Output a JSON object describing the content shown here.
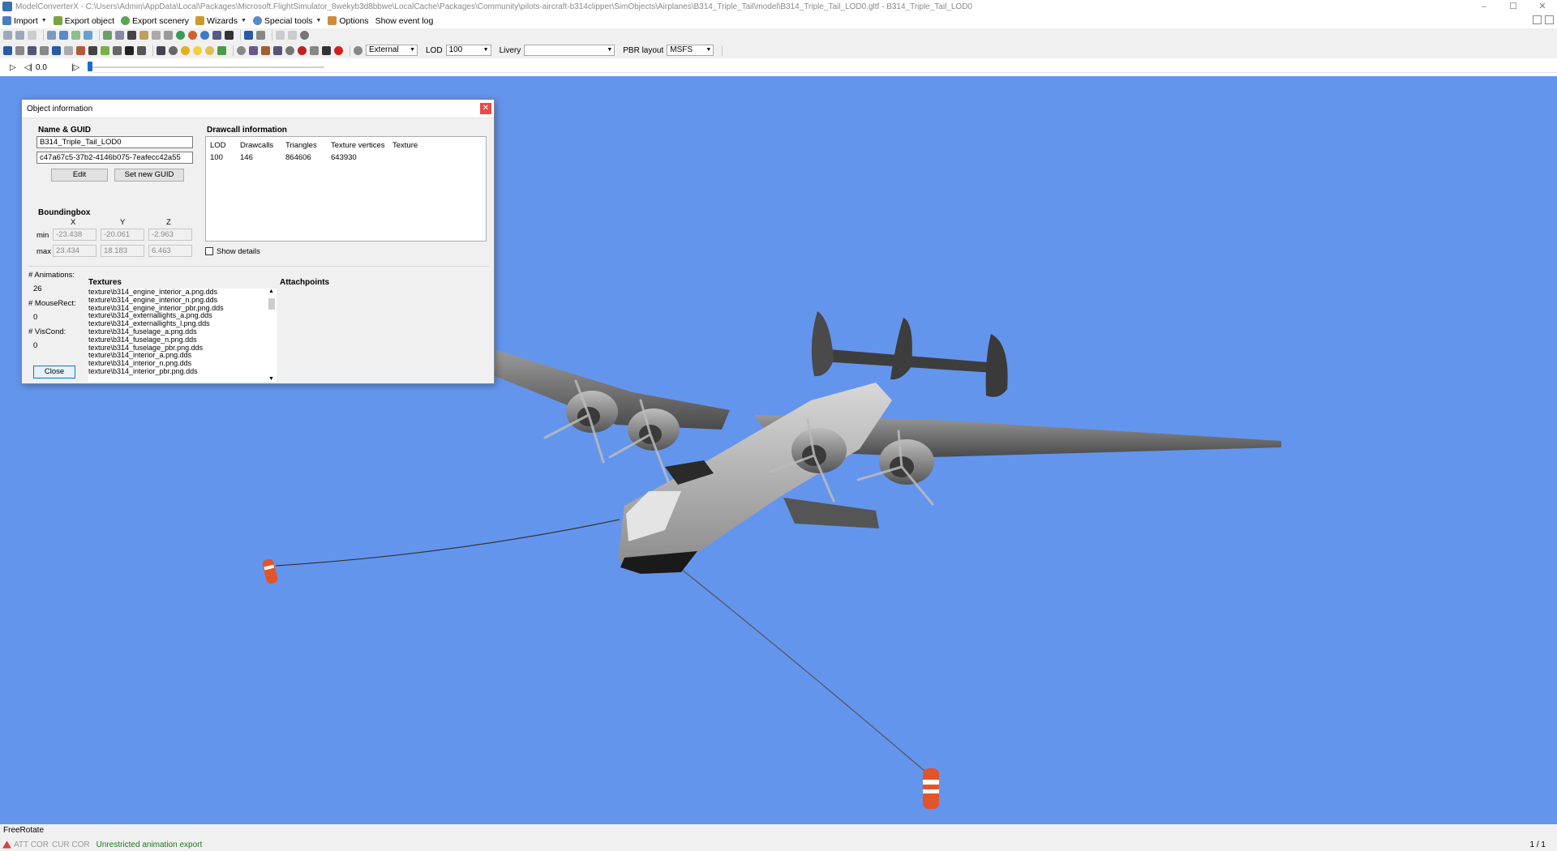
{
  "window": {
    "title": "ModelConverterX - C:\\Users\\Admin\\AppData\\Local\\Packages\\Microsoft.FlightSimulator_8wekyb3d8bbwe\\LocalCache\\Packages\\Community\\pilots-aircraft-b314clipper\\SimObjects\\Airplanes\\B314_Triple_Tail\\model\\B314_Triple_Tail_LOD0.gltf - B314_Triple_Tail_LOD0",
    "min": "–",
    "max": "☐",
    "close": "✕"
  },
  "menu": {
    "import": "Import",
    "export_object": "Export object",
    "export_scenery": "Export scenery",
    "wizards": "Wizards",
    "special_tools": "Special tools",
    "options": "Options",
    "show_event_log": "Show event log"
  },
  "toolbar": {
    "camera": "External",
    "lod_label": "LOD",
    "lod_value": "100",
    "livery_label": "Livery",
    "livery_value": "",
    "pbr_label": "PBR layout",
    "pbr_value": "MSFS"
  },
  "timeline": {
    "play": "▷",
    "prev": "◁|",
    "frame": "0.0",
    "next": "|▷"
  },
  "dialog": {
    "title": "Object information",
    "close": "✕",
    "name_guid": {
      "heading": "Name & GUID",
      "name": "B314_Triple_Tail_LOD0",
      "guid": "c47a67c5-37b2-4146b075-7eafecc42a55",
      "edit": "Edit",
      "set_new_guid": "Set new GUID"
    },
    "bbox": {
      "heading": "Boundingbox",
      "x": "X",
      "y": "Y",
      "z": "Z",
      "min_label": "min",
      "max_label": "max",
      "min": [
        "-23.438",
        "-20.061",
        "-2.963"
      ],
      "max": [
        "23.434",
        "18.183",
        "6.463"
      ]
    },
    "drawcall": {
      "heading": "Drawcall information",
      "columns": [
        "LOD",
        "Drawcalls",
        "Triangles",
        "Texture vertices",
        "Texture"
      ],
      "rows": [
        [
          "100",
          "146",
          "864606",
          "643930",
          ""
        ]
      ],
      "show_details": "Show details"
    },
    "stats": {
      "animations_label": "# Animations:",
      "animations": "26",
      "mouserect_label": "# MouseRect:",
      "mouserect": "0",
      "viscond_label": "# VisCond:",
      "viscond": "0"
    },
    "textures": {
      "heading": "Textures",
      "items": [
        "texture\\b314_engine_interior_a.png.dds",
        "texture\\b314_engine_interior_n.png.dds",
        "texture\\b314_engine_interior_pbr.png.dds",
        "texture\\b314_externallights_a.png.dds",
        "texture\\b314_externallights_l.png.dds",
        "texture\\b314_fuselage_a.png.dds",
        "texture\\b314_fuselage_n.png.dds",
        "texture\\b314_fuselage_pbr.png.dds",
        "texture\\b314_interior_a.png.dds",
        "texture\\b314_interior_n.png.dds",
        "texture\\b314_interior_pbr.png.dds"
      ]
    },
    "attachpoints": {
      "heading": "Attachpoints"
    },
    "close_button": "Close"
  },
  "status": {
    "mode": "FreeRotate",
    "att_cor": "ATT COR",
    "cur_cor": "CUR COR",
    "message": "Unrestricted animation export",
    "page": "1 / 1"
  },
  "colors": {
    "viewport": "#6495ed",
    "accent": "#1c6bd0",
    "status_ok": "#1a7a1a",
    "marker": "#e2542a"
  }
}
